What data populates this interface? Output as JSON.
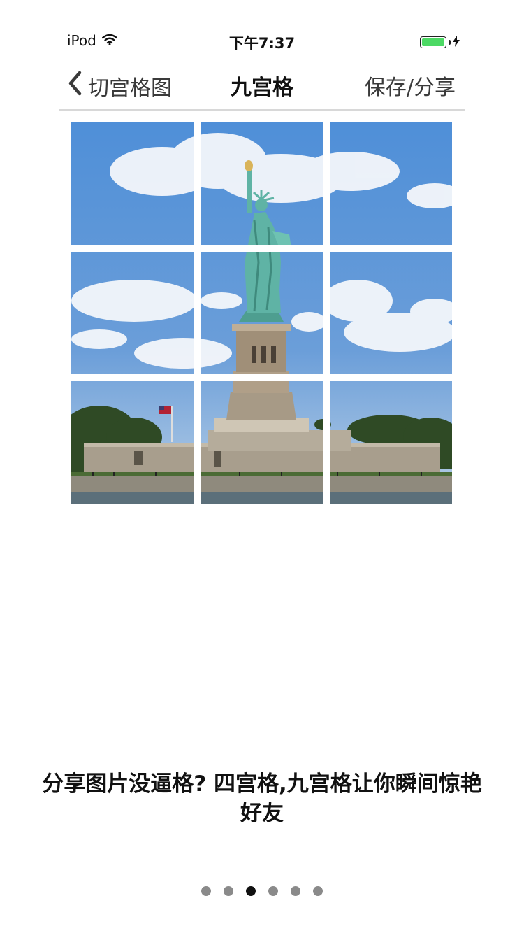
{
  "status_bar": {
    "carrier": "iPod",
    "time": "下午7:37",
    "battery_color": "#4cd964"
  },
  "nav": {
    "back_label": "切宫格图",
    "title": "九宫格",
    "action_label": "保存/分享"
  },
  "grid": {
    "rows": 3,
    "columns": 3,
    "tiles": [
      {
        "row": 1,
        "col": 1
      },
      {
        "row": 1,
        "col": 2
      },
      {
        "row": 1,
        "col": 3
      },
      {
        "row": 2,
        "col": 1
      },
      {
        "row": 2,
        "col": 2
      },
      {
        "row": 2,
        "col": 3
      },
      {
        "row": 3,
        "col": 1
      },
      {
        "row": 3,
        "col": 2
      },
      {
        "row": 3,
        "col": 3
      }
    ]
  },
  "caption": {
    "line1": "分享图片没逼格? 四宫格,九宫格让你瞬间惊艳",
    "line2": "好友"
  },
  "pager": {
    "count": 6,
    "active_index": 2
  },
  "colors": {
    "sky": "#6b9ed9",
    "statue": "#5fb3a5",
    "stone": "#a89e8d",
    "trees": "#2f4a25",
    "active_dot": "#111111",
    "inactive_dot": "#8a8a8a"
  }
}
